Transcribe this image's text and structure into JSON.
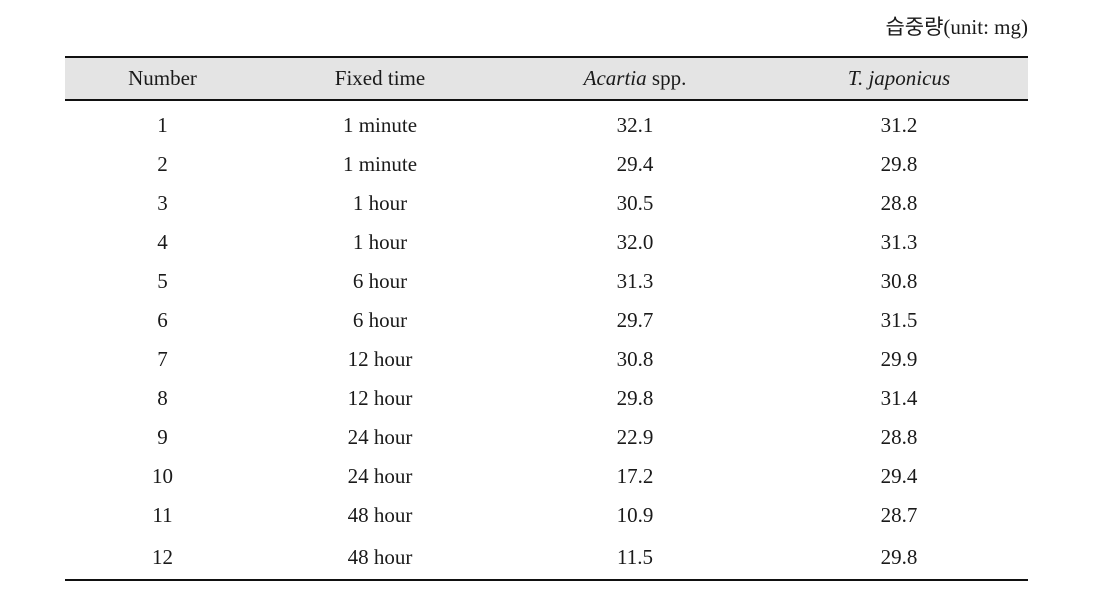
{
  "caption": "습중량(unit: mg)",
  "table": {
    "columns": [
      {
        "key": "number",
        "label": "Number",
        "label_italic_part": "",
        "label_roman_part": ""
      },
      {
        "key": "fixed_time",
        "label": "Fixed time",
        "label_italic_part": "",
        "label_roman_part": ""
      },
      {
        "key": "acartia",
        "label": "Acartia spp.",
        "label_italic_part": "Acartia",
        "label_roman_part": " spp."
      },
      {
        "key": "tjaponicus",
        "label": "T. japonicus",
        "label_italic_part": "T. japonicus",
        "label_roman_part": ""
      }
    ],
    "rows": [
      {
        "number": "1",
        "fixed_time": "1 minute",
        "acartia": "32.1",
        "tjaponicus": "31.2"
      },
      {
        "number": "2",
        "fixed_time": "1 minute",
        "acartia": "29.4",
        "tjaponicus": "29.8"
      },
      {
        "number": "3",
        "fixed_time": "1 hour",
        "acartia": "30.5",
        "tjaponicus": "28.8"
      },
      {
        "number": "4",
        "fixed_time": "1 hour",
        "acartia": "32.0",
        "tjaponicus": "31.3"
      },
      {
        "number": "5",
        "fixed_time": "6 hour",
        "acartia": "31.3",
        "tjaponicus": "30.8"
      },
      {
        "number": "6",
        "fixed_time": "6 hour",
        "acartia": "29.7",
        "tjaponicus": "31.5"
      },
      {
        "number": "7",
        "fixed_time": "12 hour",
        "acartia": "30.8",
        "tjaponicus": "29.9"
      },
      {
        "number": "8",
        "fixed_time": "12 hour",
        "acartia": "29.8",
        "tjaponicus": "31.4"
      },
      {
        "number": "9",
        "fixed_time": "24 hour",
        "acartia": "22.9",
        "tjaponicus": "28.8"
      },
      {
        "number": "10",
        "fixed_time": "24 hour",
        "acartia": "17.2",
        "tjaponicus": "29.4"
      },
      {
        "number": "11",
        "fixed_time": "48 hour",
        "acartia": "10.9",
        "tjaponicus": "28.7"
      },
      {
        "number": "12",
        "fixed_time": "48 hour",
        "acartia": "11.5",
        "tjaponicus": "29.8"
      }
    ]
  },
  "chart_data": {
    "type": "table",
    "title": "습중량(unit: mg)",
    "columns": [
      "Number",
      "Fixed time",
      "Acartia spp.",
      "T. japonicus"
    ],
    "units": "mg",
    "categories": [
      "1 minute",
      "1 minute",
      "1 hour",
      "1 hour",
      "6 hour",
      "6 hour",
      "12 hour",
      "12 hour",
      "24 hour",
      "24 hour",
      "48 hour",
      "48 hour"
    ],
    "series": [
      {
        "name": "Acartia spp.",
        "values": [
          32.1,
          29.4,
          30.5,
          32.0,
          31.3,
          29.7,
          30.8,
          29.8,
          22.9,
          17.2,
          10.9,
          11.5
        ]
      },
      {
        "name": "T. japonicus",
        "values": [
          31.2,
          29.8,
          28.8,
          31.3,
          30.8,
          31.5,
          29.9,
          31.4,
          28.8,
          29.4,
          28.7,
          29.8
        ]
      }
    ],
    "xlabel": "Fixed time",
    "ylabel": "Wet weight (mg)"
  }
}
